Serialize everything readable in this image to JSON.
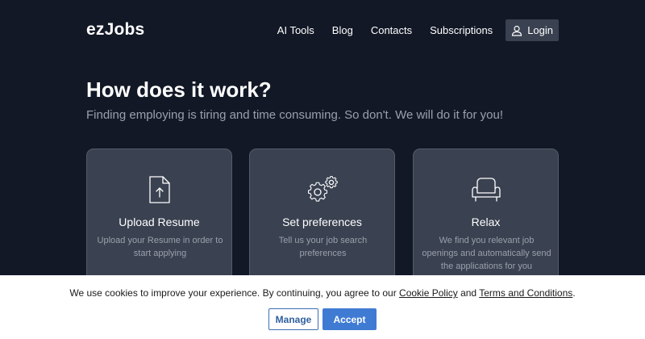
{
  "header": {
    "logo": "ezJobs",
    "nav": [
      "AI Tools",
      "Blog",
      "Contacts",
      "Subscriptions"
    ],
    "login_label": "Login",
    "login_icon": "user-icon"
  },
  "hero": {
    "title": "How does it work?",
    "subtitle": "Finding employing is tiring and time consuming. So don't. We will do it for you!"
  },
  "cards": [
    {
      "icon": "file-upload-icon",
      "title": "Upload Resume",
      "description": "Upload your Resume in order to start applying"
    },
    {
      "icon": "gears-icon",
      "title": "Set preferences",
      "description": "Tell us your job search preferences"
    },
    {
      "icon": "armchair-icon",
      "title": "Relax",
      "description": "We find you relevant job openings and automatically send the applications for you"
    }
  ],
  "cookie_banner": {
    "text_before": "We use cookies to improve your experience. By continuing, you agree to our ",
    "cookie_policy": "Cookie Policy",
    "text_and": " and ",
    "terms": "Terms and Conditions",
    "text_after": ".",
    "manage_label": "Manage",
    "accept_label": "Accept"
  },
  "colors": {
    "background": "#121826",
    "card": "#3a4150",
    "accent": "#3f7bd3"
  }
}
